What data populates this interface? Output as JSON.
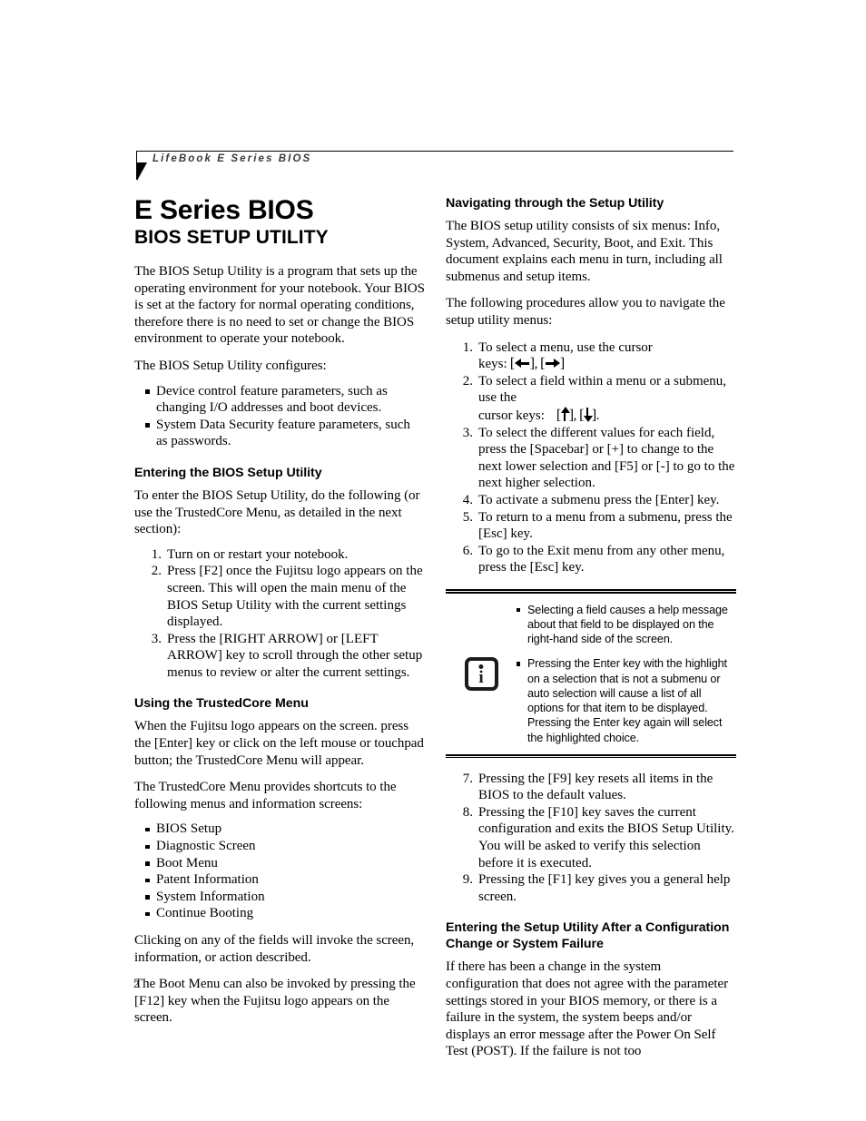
{
  "header": {
    "running_head": "LifeBook E Series BIOS"
  },
  "folio": {
    "page_number": "2"
  },
  "left_column": {
    "doc_title": "E Series BIOS",
    "doc_subtitle": "BIOS SETUP UTILITY",
    "intro_paragraph": "The BIOS Setup Utility is a program that sets up the operating environment for your notebook. Your BIOS is set at the factory for normal operating conditions, therefore there is no need to set or change the BIOS environment to operate your notebook.",
    "configures_lead": "The BIOS Setup Utility configures:",
    "configures_items": [
      "Device control feature parameters, such as changing I/O addresses and boot devices.",
      "System Data Security feature parameters, such as passwords."
    ],
    "entering_heading": "Entering the BIOS Setup Utility",
    "entering_lead": "To enter the BIOS Setup Utility, do the following (or use the TrustedCore Menu, as detailed in the next section):",
    "entering_steps": [
      "Turn on or restart your notebook.",
      "Press [F2] once the Fujitsu logo appears on the screen. This will open the main menu of the BIOS Setup Utility with the current settings displayed.",
      "Press the [RIGHT ARROW] or [LEFT ARROW] key to scroll through the other setup menus to review or alter the current settings."
    ],
    "trustedcore_heading": "Using the TrustedCore Menu",
    "trustedcore_paragraph_1": "When the Fujitsu logo appears on the screen. press the [Enter] key or click on the left mouse or touchpad button; the TrustedCore Menu will appear.",
    "trustedcore_paragraph_2": "The TrustedCore Menu provides shortcuts to the following menus and information screens:",
    "trustedcore_items": [
      "BIOS Setup",
      "Diagnostic Screen",
      "Boot Menu",
      "Patent Information",
      "System Information",
      "Continue Booting"
    ],
    "trustedcore_paragraph_3": "Clicking on any of the fields will invoke the screen, information, or action described.",
    "trustedcore_paragraph_4": "The Boot Menu can also be invoked by pressing the [F12] key when the Fujitsu logo appears on the screen."
  },
  "right_column": {
    "navigating_heading": "Navigating through the Setup Utility",
    "navigating_paragraph_1": "The BIOS setup utility consists of six menus: Info, System, Advanced, Security, Boot, and Exit. This document explains each menu in turn, including all submenus and setup items.",
    "navigating_paragraph_2": "The following procedures allow you to navigate the setup utility menus:",
    "step_1_text": "To select a menu, use the cursor keys:",
    "step_1_keys": {
      "left_bracket": "[",
      "right_bracket": "]",
      "separator": ",",
      "left_arrow_icon": "left-arrow-icon",
      "right_arrow_icon": "right-arrow-icon"
    },
    "step_2_text": "To select a field within a menu or a submenu, use the",
    "step_2_text_cont": "cursor keys:",
    "step_2_keys": {
      "up_arrow_icon": "up-arrow-icon",
      "down_arrow_icon": "down-arrow-icon",
      "terminator": "."
    },
    "step_3_text": "To select the different values for each field, press the [Spacebar] or [+] to change to the next lower selection and [F5] or [-] to go to the next higher selection.",
    "step_4_text": "To activate a submenu press the [Enter] key.",
    "step_5_text": "To return to a menu from a submenu, press the [Esc] key.",
    "step_6_text": "To go to the Exit menu from any other menu, press the [Esc] key.",
    "note_box": {
      "icon": "info-icon",
      "icon_letter": "i",
      "bullets": [
        "Selecting a field causes a help message about that field to be displayed on the right-hand side of the screen.",
        "Pressing the Enter key with the highlight on a selection that is not a submenu or auto selection will cause a list of all options for that item to be displayed. Pressing the Enter key again will select the highlighted choice."
      ]
    },
    "step_7_text": "Pressing the [F9] key resets all items in the BIOS to the default values.",
    "step_8_text": "Pressing the [F10] key saves the current configuration and exits the BIOS Setup Utility. You will be asked to verify this selection before it is executed.",
    "step_9_text": "Pressing the [F1] key gives you a general help screen.",
    "step_numbers": {
      "n1": "1.",
      "n2": "2.",
      "n3": "3.",
      "n4": "4.",
      "n5": "5.",
      "n6": "6.",
      "n7": "7.",
      "n8": "8.",
      "n9": "9."
    },
    "config_change_heading_line1": "Entering the Setup Utility After a Configuration",
    "config_change_heading_line2": "Change or System Failure",
    "config_change_paragraph": "If there has been a change in the system configuration that does not agree with the parameter settings stored in your BIOS memory, or there is a failure in the system, the system beeps and/or displays an error message after the Power On Self Test (POST). If the failure is not too"
  }
}
